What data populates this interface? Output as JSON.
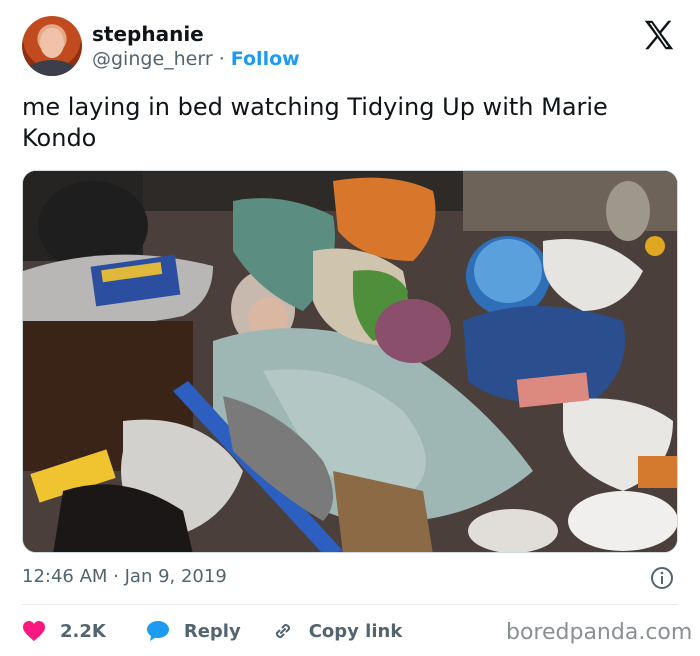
{
  "author": {
    "display_name": "stephanie",
    "handle": "@ginge_herr",
    "separator": "·",
    "follow_label": "Follow"
  },
  "platform_icon": "x-logo-icon",
  "tweet": {
    "text": "me laying in bed watching Tidying Up with Marie Kondo"
  },
  "media": {
    "description_icon": "photo"
  },
  "meta": {
    "timestamp": "12:46 AM · Jan 9, 2019"
  },
  "actions": {
    "likes": "2.2K",
    "reply_label": "Reply",
    "copy_link_label": "Copy link"
  },
  "watermark": "boredpanda.com",
  "colors": {
    "accent": "#1d9bf0",
    "like": "#f91880",
    "text": "#0f1419",
    "muted": "#536471"
  }
}
